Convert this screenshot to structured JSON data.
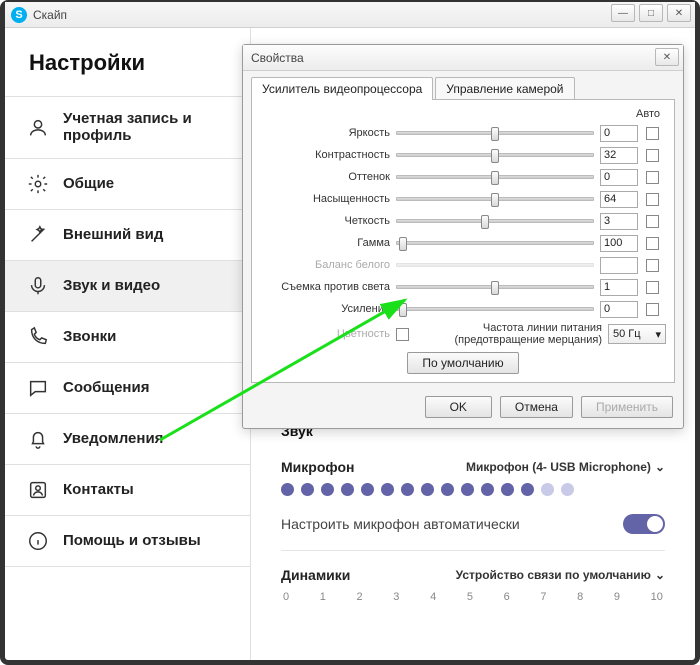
{
  "window": {
    "title": "Скайп",
    "minimize": "—",
    "maximize": "□",
    "close": "✕"
  },
  "sidebar": {
    "title": "Настройки",
    "items": [
      {
        "label": "Учетная запись и профиль"
      },
      {
        "label": "Общие"
      },
      {
        "label": "Внешний вид"
      },
      {
        "label": "Звук и видео"
      },
      {
        "label": "Звонки"
      },
      {
        "label": "Сообщения"
      },
      {
        "label": "Уведомления"
      },
      {
        "label": "Контакты"
      },
      {
        "label": "Помощь и отзывы"
      }
    ]
  },
  "dialog": {
    "title": "Свойства",
    "tabs": {
      "tab1": "Усилитель видеопроцессора",
      "tab2": "Управление камерой"
    },
    "auto_header": "Авто",
    "sliders": [
      {
        "label": "Яркость",
        "value": "0",
        "pos": 50
      },
      {
        "label": "Контрастность",
        "value": "32",
        "pos": 50
      },
      {
        "label": "Оттенок",
        "value": "0",
        "pos": 50
      },
      {
        "label": "Насыщенность",
        "value": "64",
        "pos": 50
      },
      {
        "label": "Четкость",
        "value": "3",
        "pos": 45
      },
      {
        "label": "Гамма",
        "value": "100",
        "pos": 3
      },
      {
        "label": "Баланс белого",
        "value": "",
        "pos": -1,
        "disabled": true
      },
      {
        "label": "Съемка против света",
        "value": "1",
        "pos": 50
      },
      {
        "label": "Усиление",
        "value": "0",
        "pos": 3
      }
    ],
    "color_label": "Цветность",
    "freq_label": "Частота линии питания (предотвращение мерцания)",
    "freq_value": "50 Гц",
    "default_btn": "По умолчанию",
    "ok": "OK",
    "cancel": "Отмена",
    "apply": "Применить"
  },
  "main": {
    "sound_section": "Звук",
    "microphone_label": "Микрофон",
    "microphone_selected": "Микрофон (4- USB Microphone)",
    "auto_mic": "Настроить микрофон автоматически",
    "speakers_label": "Динамики",
    "speakers_selected": "Устройство связи по умолчанию",
    "scale": [
      "0",
      "1",
      "2",
      "3",
      "4",
      "5",
      "6",
      "7",
      "8",
      "9",
      "10"
    ]
  }
}
